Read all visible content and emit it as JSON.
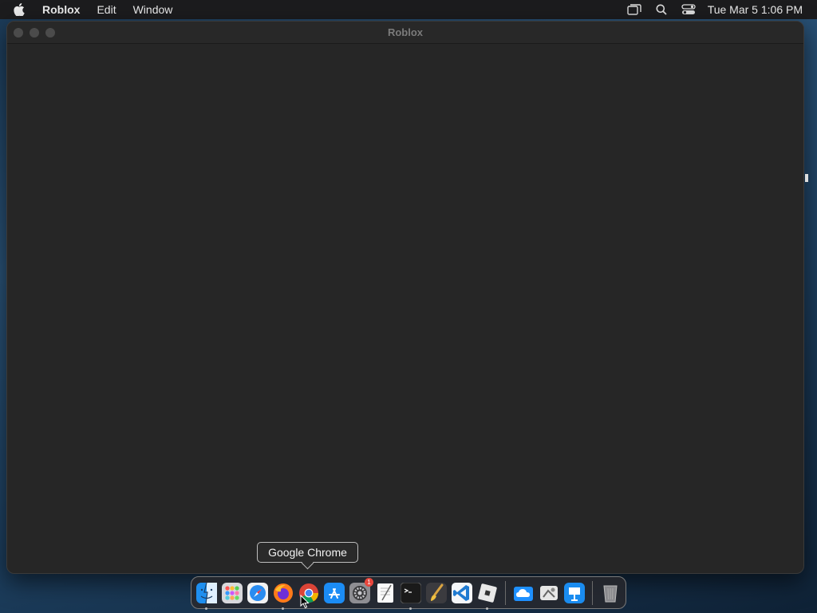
{
  "menubar": {
    "app_name": "Roblox",
    "items": [
      "Edit",
      "Window"
    ],
    "clock": "Tue Mar 5  1:06 PM",
    "icons": [
      "screen-mirroring-icon",
      "search-icon",
      "control-center-icon"
    ]
  },
  "window": {
    "title": "Roblox"
  },
  "tooltip": {
    "text": "Google Chrome"
  },
  "dock": {
    "apps": [
      {
        "name": "Finder",
        "icon": "finder-icon",
        "running": true
      },
      {
        "name": "Launchpad",
        "icon": "launchpad-icon",
        "running": false
      },
      {
        "name": "Safari",
        "icon": "safari-icon",
        "running": false
      },
      {
        "name": "Firefox",
        "icon": "firefox-icon",
        "running": true
      },
      {
        "name": "Google Chrome",
        "icon": "chrome-icon",
        "running": false
      },
      {
        "name": "App Store",
        "icon": "app-store-icon",
        "running": false
      },
      {
        "name": "System Settings",
        "icon": "system-settings-icon",
        "running": false,
        "badge": "1"
      },
      {
        "name": "TextEdit",
        "icon": "textedit-icon",
        "running": false
      },
      {
        "name": "Terminal",
        "icon": "terminal-icon",
        "running": true
      },
      {
        "name": "Brush",
        "icon": "brush-app-icon",
        "running": false
      },
      {
        "name": "Visual Studio Code",
        "icon": "vscode-icon",
        "running": false
      },
      {
        "name": "Roblox",
        "icon": "roblox-icon",
        "running": true
      },
      {
        "name": "iCloud Drive",
        "icon": "cloud-folder-icon",
        "running": false
      },
      {
        "name": "Utility",
        "icon": "utility-icon",
        "running": false
      },
      {
        "name": "Keynote",
        "icon": "keynote-icon",
        "running": false
      },
      {
        "name": "Trash",
        "icon": "trash-icon",
        "running": false
      }
    ]
  },
  "colors": {
    "menubar_bg": "#1c1c1e",
    "window_bg": "#262626",
    "tooltip_border": "#bdbdbd"
  }
}
